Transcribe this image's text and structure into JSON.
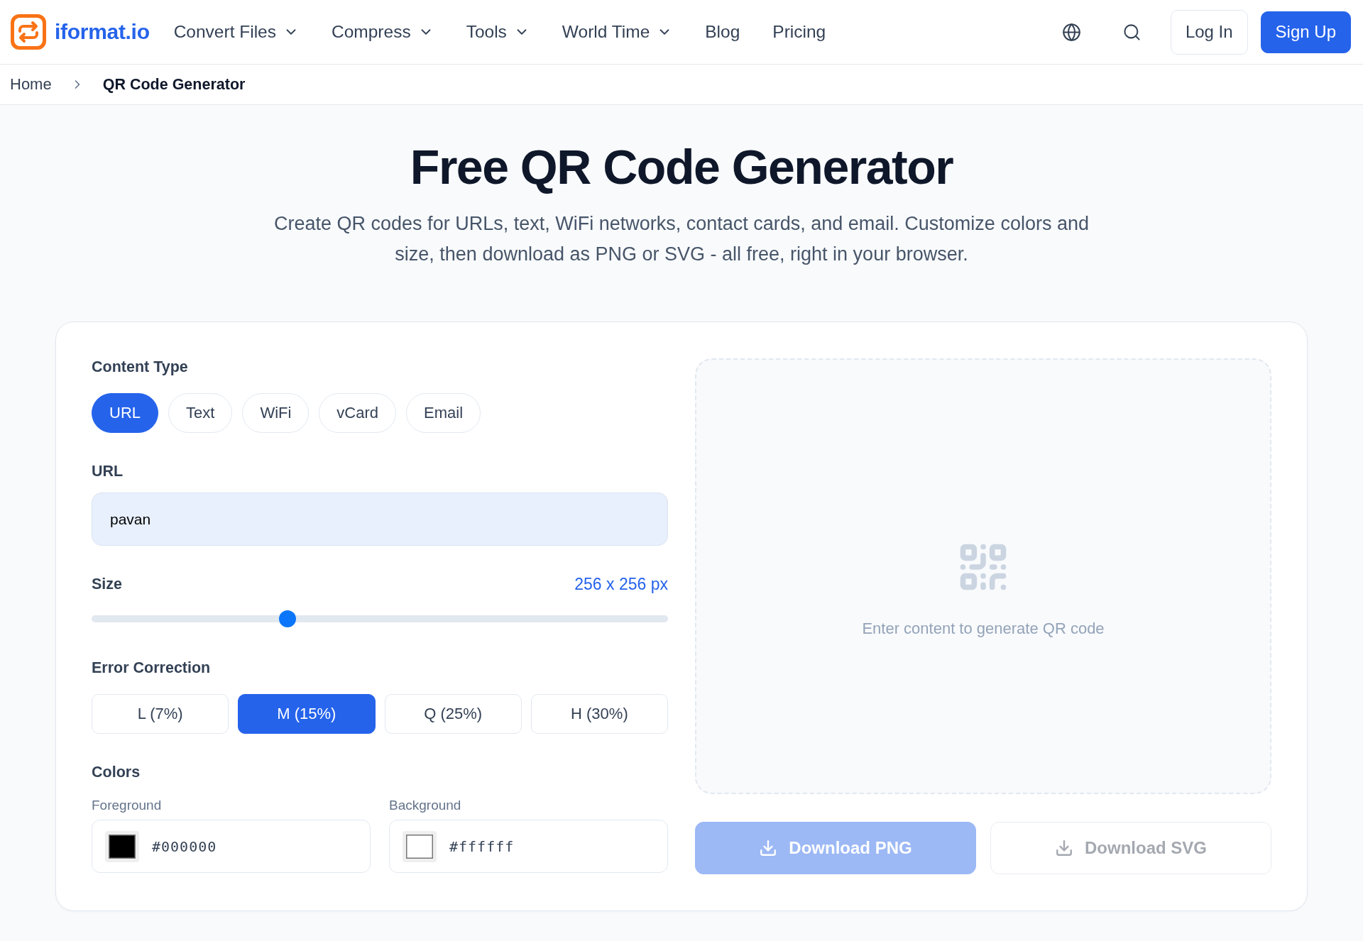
{
  "header": {
    "logo": {
      "text": "iformat.io"
    },
    "nav": [
      {
        "label": "Convert Files",
        "has_menu": true
      },
      {
        "label": "Compress",
        "has_menu": true
      },
      {
        "label": "Tools",
        "has_menu": true
      },
      {
        "label": "World Time",
        "has_menu": true
      },
      {
        "label": "Blog",
        "has_menu": false
      },
      {
        "label": "Pricing",
        "has_menu": false
      }
    ],
    "auth_buttons": [
      {
        "label": "Log In",
        "kind": "outline"
      },
      {
        "label": "Sign Up",
        "kind": "primary"
      }
    ]
  },
  "breadcrumb": [
    {
      "label": "Home",
      "current": false
    },
    {
      "label": "QR Code Generator",
      "current": true
    }
  ],
  "hero": {
    "title": "Free QR Code Generator",
    "subtitle": "Create QR codes for URLs, text, WiFi networks, contact cards, and email. Customize colors and size, then download as PNG or SVG - all free, right in your browser."
  },
  "generator": {
    "content_type": {
      "label": "Content Type",
      "options": [
        {
          "label": "URL",
          "selected": true
        },
        {
          "label": "Text",
          "selected": false
        },
        {
          "label": "WiFi",
          "selected": false
        },
        {
          "label": "vCard",
          "selected": false
        },
        {
          "label": "Email",
          "selected": false
        }
      ]
    },
    "url_field": {
      "label": "URL",
      "value": "pavan"
    },
    "size": {
      "label": "Size",
      "reading": "256 x 256 px",
      "level": 0.34
    },
    "error_correction": {
      "label": "Error Correction",
      "options": [
        {
          "label": "L (7%)",
          "selected": false
        },
        {
          "label": "M (15%)",
          "selected": true
        },
        {
          "label": "Q (25%)",
          "selected": false
        },
        {
          "label": "H (30%)",
          "selected": false
        }
      ]
    },
    "colors": {
      "label": "Colors",
      "fields": [
        {
          "label": "Foreground",
          "value": "#000000",
          "color": "#000000"
        },
        {
          "label": "Background",
          "value": "#ffffff",
          "color": "#ffffff"
        }
      ]
    },
    "preview": {
      "message": "Enter content to generate QR code"
    },
    "downloads": [
      {
        "label": "Download PNG",
        "kind": "primary",
        "disabled": true
      },
      {
        "label": "Download SVG",
        "kind": "secondary",
        "disabled": true
      }
    ]
  }
}
